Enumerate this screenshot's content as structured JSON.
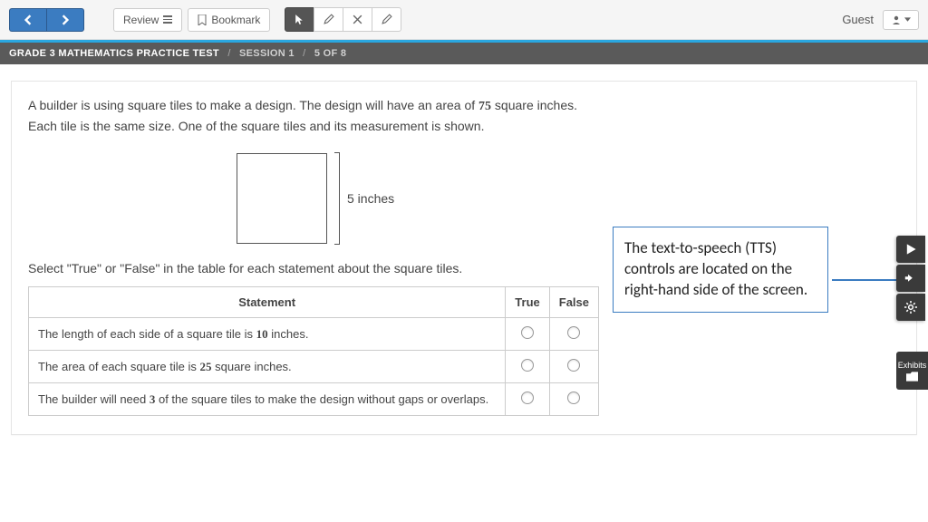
{
  "toolbar": {
    "review_label": "Review",
    "bookmark_label": "Bookmark",
    "guest_label": "Guest"
  },
  "breadcrumb": {
    "test": "GRADE 3 MATHEMATICS PRACTICE TEST",
    "session": "SESSION 1",
    "progress": "5 OF 8"
  },
  "question": {
    "prompt_before": "A builder is using square tiles to make a design. The design will have an area of ",
    "area_value": "75",
    "prompt_after": " square inches. Each tile is the same size. One of the square tiles and its measurement is shown.",
    "dimension_label": "5 inches",
    "instruction": "Select \"True\" or \"False\" in the table for each statement about the square tiles."
  },
  "table": {
    "header_statement": "Statement",
    "header_true": "True",
    "header_false": "False",
    "rows": [
      {
        "before": "The length of each side of a square tile is ",
        "num": "10",
        "after": " inches."
      },
      {
        "before": "The area of each square tile is ",
        "num": "25",
        "after": " square inches."
      },
      {
        "before": "The builder will need ",
        "num": "3",
        "after": " of the square tiles to make the design without gaps or overlaps."
      }
    ]
  },
  "callout": "The text-to-speech (TTS) controls are located on the right-hand side of the screen.",
  "side": {
    "exhibits_label": "Exhibits"
  }
}
